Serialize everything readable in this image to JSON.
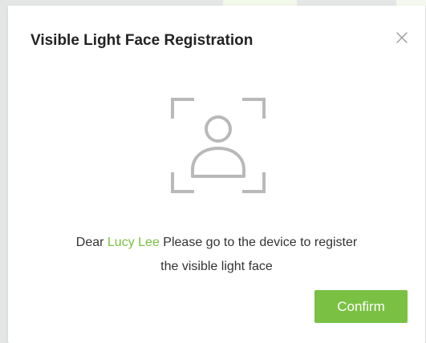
{
  "dialog": {
    "title": "Visible Light Face Registration",
    "close_icon": "close-icon",
    "face_icon": "face-scan-icon"
  },
  "message": {
    "prefix": "Dear",
    "user_name": "Lucy Lee",
    "line1_suffix": "Please go to the device to register",
    "line2": "the visible light face"
  },
  "actions": {
    "confirm_label": "Confirm"
  },
  "colors": {
    "accent": "#7ac143",
    "title_text": "#232323",
    "body_text": "#333333",
    "icon_stroke": "#b9b9b9",
    "backdrop": "#e3e6e4"
  }
}
